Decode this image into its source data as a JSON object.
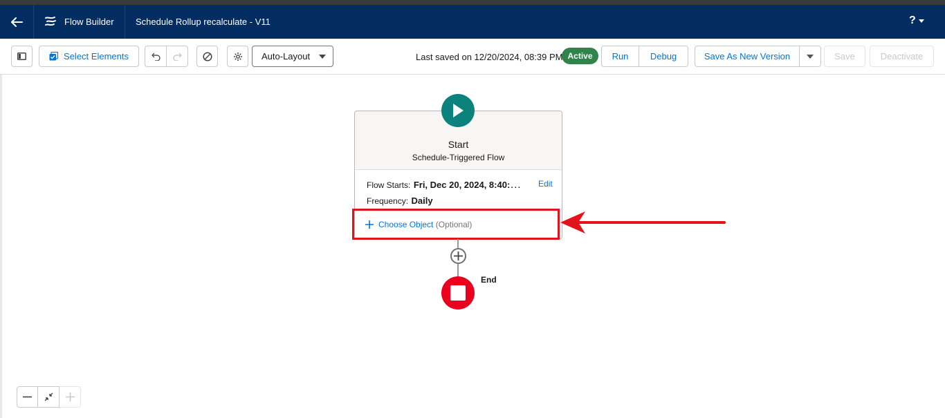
{
  "header": {
    "app_name": "Flow Builder",
    "flow_name": "Schedule Rollup recalculate - V11",
    "help_label": "?",
    "back_icon": "back-arrow-icon",
    "app_icon": "flow-icon"
  },
  "toolbar": {
    "select_elements_label": "Select Elements",
    "layout_mode": "Auto-Layout",
    "last_saved": "Last saved on 12/20/2024, 08:39 PM",
    "status_badge": "Active",
    "run_label": "Run",
    "debug_label": "Debug",
    "save_as_new_version_label": "Save As New Version",
    "save_label": "Save",
    "deactivate_label": "Deactivate"
  },
  "start_node": {
    "title": "Start",
    "subtitle": "Schedule-Triggered Flow",
    "flow_starts_label": "Flow Starts:",
    "flow_starts_value": "Fri, Dec 20, 2024, 8:40:0...",
    "frequency_label": "Frequency:",
    "frequency_value": "Daily",
    "edit_label": "Edit",
    "choose_object_label": "Choose Object",
    "choose_object_hint": "(Optional)"
  },
  "end_node": {
    "label": "End"
  },
  "colors": {
    "header_bg": "#032d60",
    "brand_blue": "#0176d3",
    "active_green": "#2e844a",
    "start_teal": "#0b827c",
    "end_red": "#ea001e",
    "annotation_red": "#e1141c"
  }
}
